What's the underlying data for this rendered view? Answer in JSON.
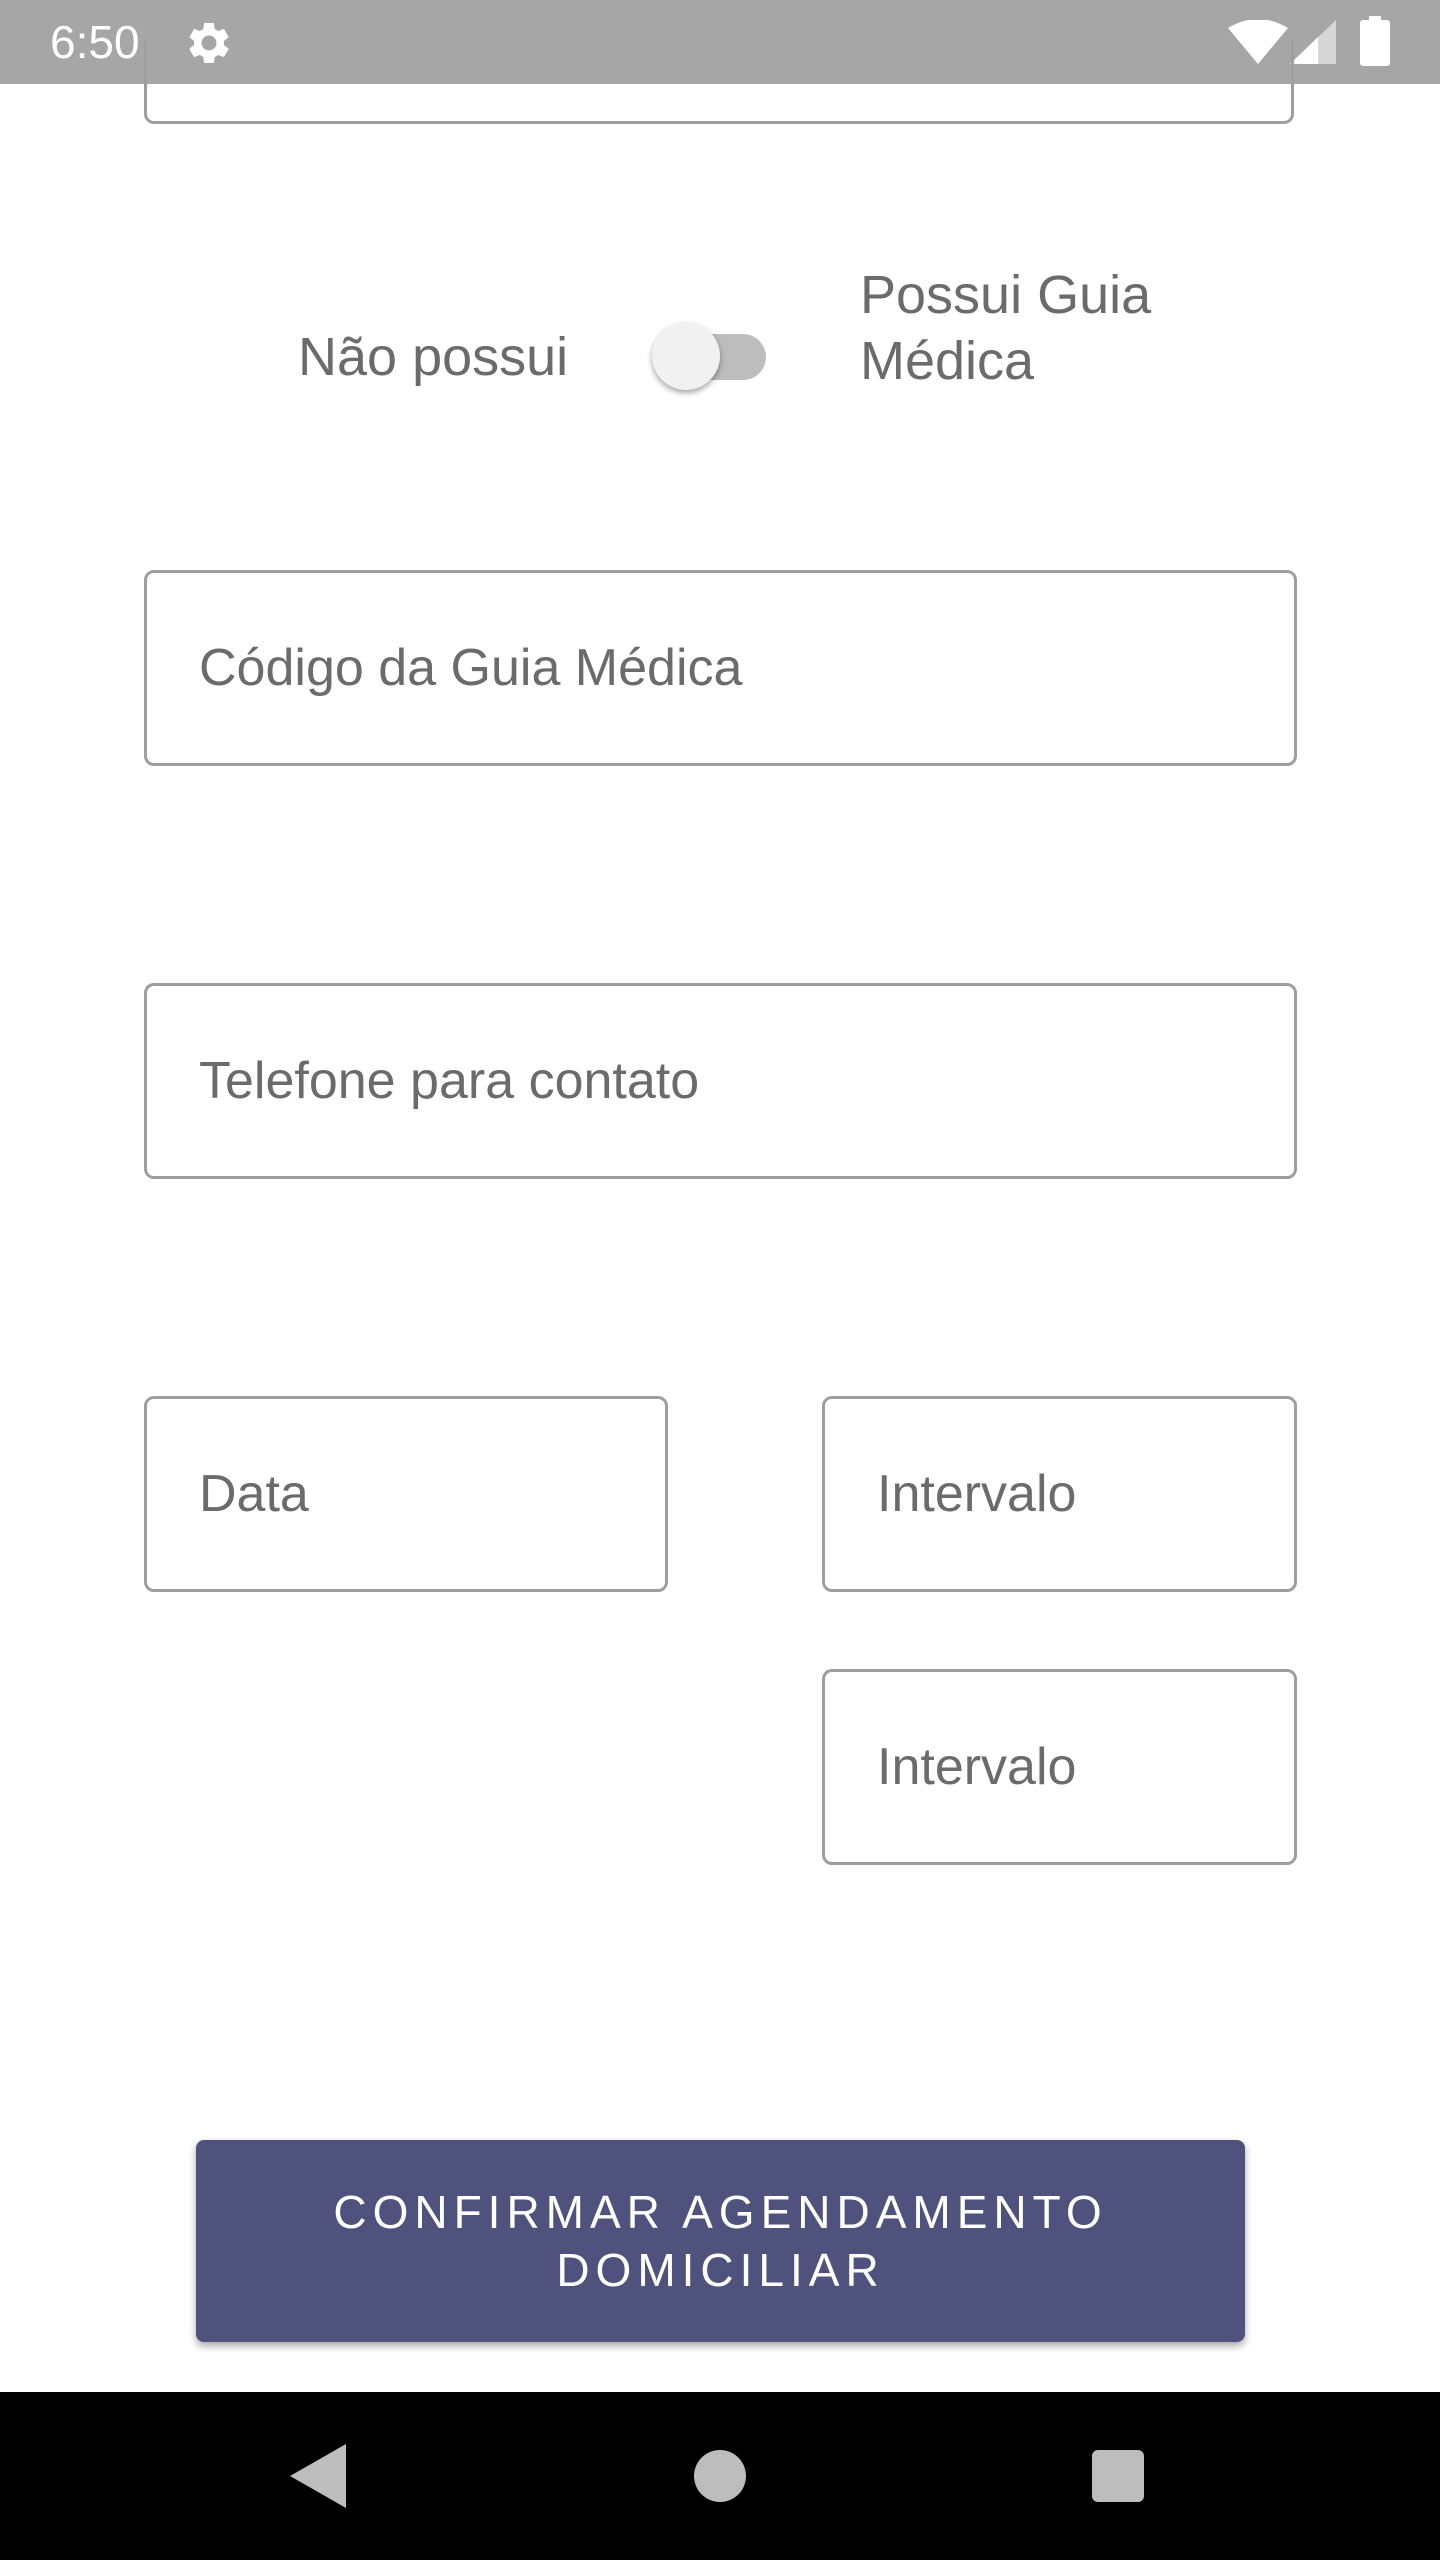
{
  "status_bar": {
    "time": "6:50",
    "icons": [
      "gear-icon",
      "wifi-icon",
      "signal-icon",
      "battery-icon"
    ]
  },
  "guia_switch": {
    "off_label": "Não possui",
    "on_label": "Possui Guia Médica",
    "checked": false
  },
  "form": {
    "guia_code_placeholder": "Código da Guia Médica",
    "telefone_placeholder": "Telefone para contato",
    "data_placeholder": "Data",
    "intervalo_1_placeholder": "Intervalo",
    "intervalo_2_placeholder": "Intervalo"
  },
  "confirm_button": {
    "label": "CONFIRMAR AGENDAMENTO DOMICILIAR"
  },
  "nav_bar": {
    "icons": [
      "back-icon",
      "home-icon",
      "recents-icon"
    ]
  },
  "colors": {
    "status_bar_bg": "#a6a6a6",
    "button_bg": "#4e527c",
    "field_border": "#9e9e9e",
    "label_text": "#6b6b6b",
    "nav_bar_bg": "#000000"
  }
}
